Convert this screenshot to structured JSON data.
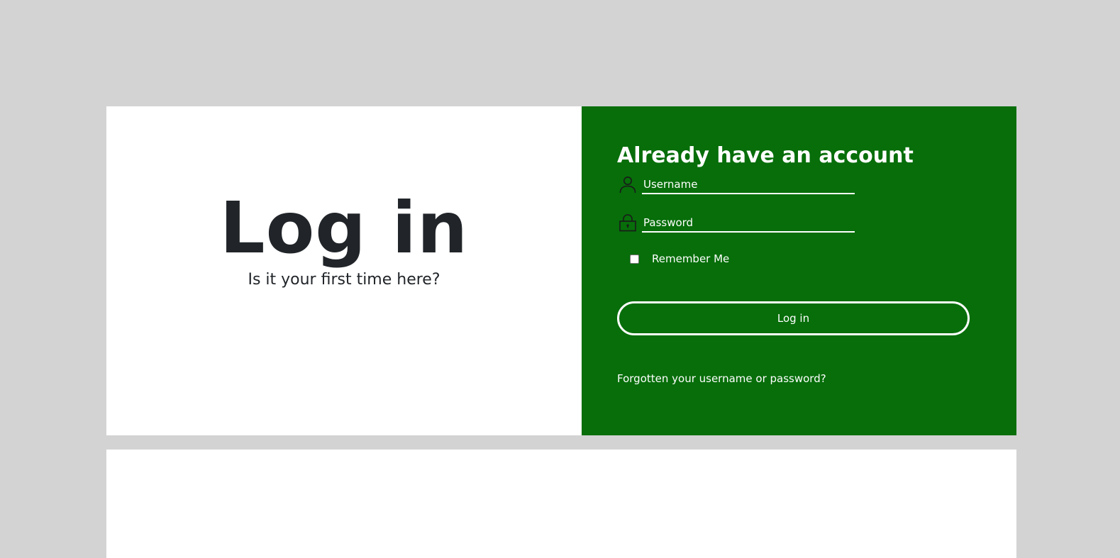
{
  "left": {
    "title": "Log in",
    "subtitle": "Is it your first time here?"
  },
  "right": {
    "heading": "Already have an account",
    "username": {
      "placeholder": "Username",
      "value": "",
      "icon": "user-icon"
    },
    "password": {
      "placeholder": "Password",
      "value": "",
      "icon": "lock-icon"
    },
    "remember": {
      "label": "Remember Me",
      "checked": false
    },
    "login_button": "Log in",
    "forgot_link": "Forgotten your username or password?"
  },
  "colors": {
    "page_background": "#d3d3d3",
    "panel_green": "#076e0a",
    "title_text": "#212529",
    "white": "#ffffff"
  }
}
